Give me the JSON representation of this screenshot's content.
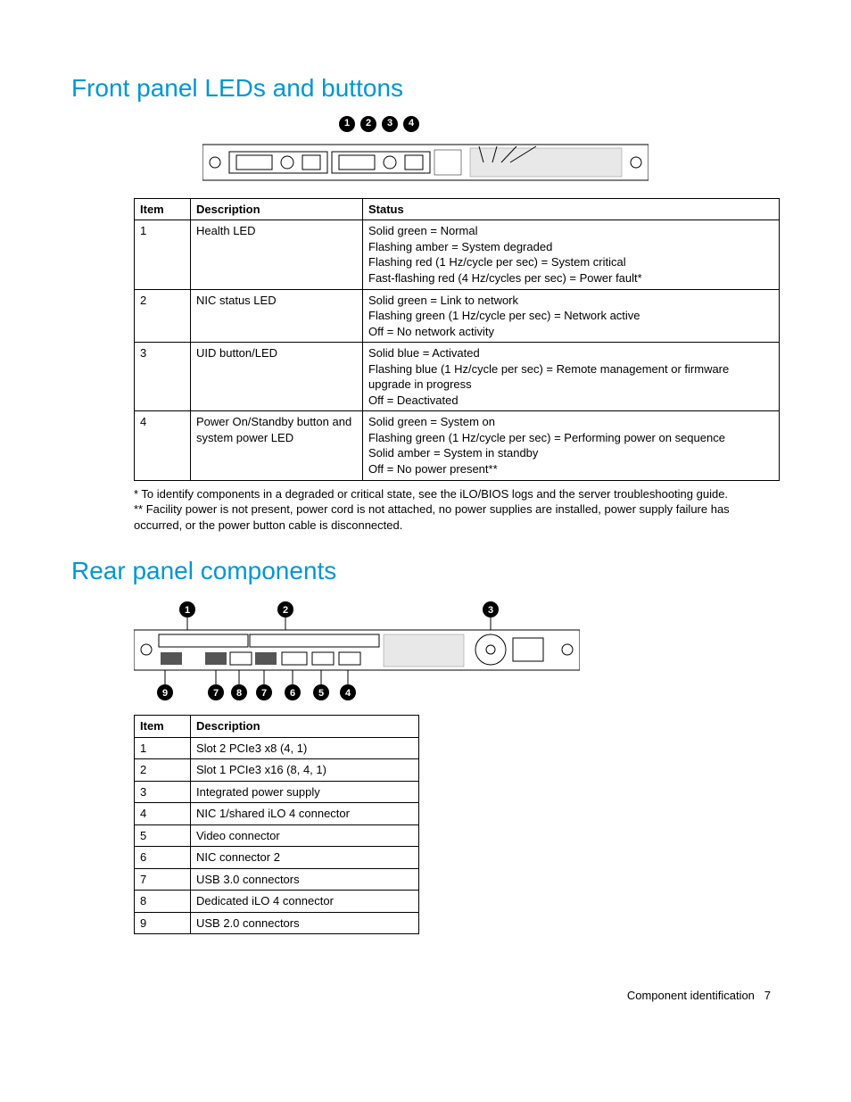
{
  "section1": {
    "heading": "Front panel LEDs and buttons",
    "callouts": [
      "1",
      "2",
      "3",
      "4"
    ],
    "table": {
      "headers": [
        "Item",
        "Description",
        "Status"
      ],
      "rows": [
        {
          "item": "1",
          "desc": "Health LED",
          "status": [
            "Solid green = Normal",
            "Flashing amber = System degraded",
            "Flashing red (1 Hz/cycle per sec) = System critical",
            "Fast-flashing red (4 Hz/cycles per sec) = Power fault*"
          ]
        },
        {
          "item": "2",
          "desc": "NIC status LED",
          "status": [
            "Solid green = Link to network",
            "Flashing green (1 Hz/cycle per sec) = Network active",
            "Off = No network activity"
          ]
        },
        {
          "item": "3",
          "desc": "UID button/LED",
          "status": [
            "Solid blue = Activated",
            "Flashing blue (1 Hz/cycle per sec) = Remote management or firmware upgrade in progress",
            "Off = Deactivated"
          ]
        },
        {
          "item": "4",
          "desc": "Power On/Standby button and system power LED",
          "status": [
            "Solid green = System on",
            "Flashing green (1 Hz/cycle per sec) = Performing power on sequence",
            "Solid amber = System in standby",
            "Off = No power present**"
          ]
        }
      ]
    },
    "notes": [
      "* To identify components in a degraded or critical state, see the iLO/BIOS logs and the server troubleshooting guide.",
      "** Facility power is not present, power cord is not attached, no power supplies are installed, power supply failure has occurred, or the power button cable is disconnected."
    ]
  },
  "section2": {
    "heading": "Rear panel components",
    "callouts_top": [
      "1",
      "2",
      "3"
    ],
    "callouts_bottom": [
      "9",
      "7",
      "8",
      "7",
      "6",
      "5",
      "4"
    ],
    "table": {
      "headers": [
        "Item",
        "Description"
      ],
      "rows": [
        {
          "item": "1",
          "desc": "Slot 2 PCIe3 x8 (4, 1)"
        },
        {
          "item": "2",
          "desc": "Slot 1 PCIe3 x16 (8, 4, 1)"
        },
        {
          "item": "3",
          "desc": "Integrated power supply"
        },
        {
          "item": "4",
          "desc": "NIC 1/shared iLO 4 connector"
        },
        {
          "item": "5",
          "desc": "Video connector"
        },
        {
          "item": "6",
          "desc": "NIC connector 2"
        },
        {
          "item": "7",
          "desc": "USB 3.0 connectors"
        },
        {
          "item": "8",
          "desc": "Dedicated iLO 4 connector"
        },
        {
          "item": "9",
          "desc": "USB 2.0 connectors"
        }
      ]
    }
  },
  "footer": {
    "section": "Component identification",
    "page": "7"
  }
}
